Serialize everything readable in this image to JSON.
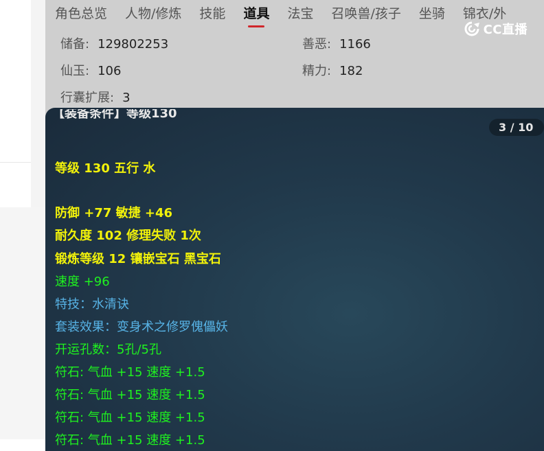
{
  "tabs": [
    "角色总览",
    "人物/修炼",
    "技能",
    "道具",
    "法宝",
    "召唤兽/孩子",
    "坐骑",
    "锦衣/外"
  ],
  "active_tab_index": 3,
  "logo": {
    "text": "CC直播"
  },
  "stats": {
    "reserve_label": "储备:",
    "reserve_value": "129802253",
    "goodevil_label": "善恶:",
    "goodevil_value": "1166",
    "jade_label": "仙玉:",
    "jade_value": "106",
    "energy_label": "精力:",
    "energy_value": "182",
    "bag_label": "行囊扩展:",
    "bag_value": "3"
  },
  "tooltip": {
    "header": "【装备条件】等级130",
    "pager": "3 / 10",
    "lines": [
      {
        "text": "等级 130 五行 水",
        "color": "yellow"
      },
      {
        "text": "防御 +77 敏捷 +46",
        "color": "yellow"
      },
      {
        "text": "耐久度 102 修理失败 1次",
        "color": "yellow"
      },
      {
        "text": "锻炼等级 12 镶嵌宝石 黑宝石",
        "color": "yellow"
      },
      {
        "text": "速度 +96",
        "color": "green"
      },
      {
        "text": "特技：水清诀",
        "color": "blue"
      },
      {
        "text": "套装效果：变身术之修罗傀儡妖",
        "color": "blue"
      },
      {
        "text": "开运孔数：5孔/5孔",
        "color": "green"
      },
      {
        "text": "符石: 气血 +15 速度 +1.5",
        "color": "green"
      },
      {
        "text": "符石: 气血 +15 速度 +1.5",
        "color": "green"
      },
      {
        "text": "符石: 气血 +15 速度 +1.5",
        "color": "green"
      },
      {
        "text": "符石: 气血 +15 速度 +1.5",
        "color": "green"
      }
    ]
  },
  "colors": {
    "yellow": "#f2f20a",
    "green": "#1ff21f",
    "blue": "#57b3e6",
    "accent": "#d0262b"
  }
}
